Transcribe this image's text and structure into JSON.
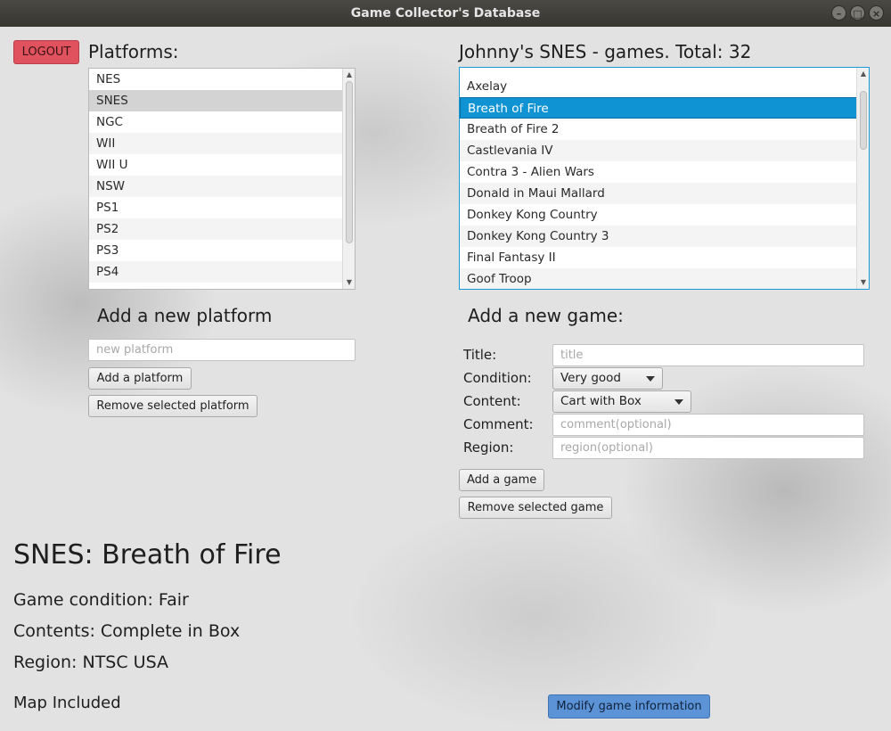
{
  "window": {
    "title": "Game Collector's Database"
  },
  "header": {
    "logout_label": "LOGOUT"
  },
  "platforms": {
    "heading": "Platforms:",
    "items": [
      "NES",
      "SNES",
      "NGC",
      "WII",
      "WII U",
      "NSW",
      "PS1",
      "PS2",
      "PS3",
      "PS4"
    ],
    "selected": "SNES",
    "add_heading": "Add a new platform",
    "new_placeholder": "new platform",
    "add_button": "Add a platform",
    "remove_button": "Remove selected platform"
  },
  "games": {
    "heading": "Johnny's SNES - games. Total: 32",
    "items": [
      "Axelay",
      "Breath of Fire",
      "Breath of Fire 2",
      "Castlevania IV",
      "Contra 3 - Alien Wars",
      "Donald in Maui Mallard",
      "Donkey Kong Country",
      "Donkey Kong Country 3",
      "Final Fantasy II",
      "Goof Troop"
    ],
    "selected": "Breath of Fire",
    "add_heading": "Add a new game:",
    "form": {
      "title_label": "Title:",
      "title_placeholder": "title",
      "condition_label": "Condition:",
      "condition_value": "Very good",
      "content_label": "Content:",
      "content_value": "Cart with Box",
      "comment_label": "Comment:",
      "comment_placeholder": "comment(optional)",
      "region_label": "Region:",
      "region_placeholder": "region(optional)"
    },
    "add_button": "Add a game",
    "remove_button": "Remove selected game"
  },
  "details": {
    "title": "SNES: Breath of Fire",
    "condition": "Game condition: Fair",
    "contents": "Contents: Complete in Box",
    "region": "Region: NTSC USA",
    "note": "Map Included",
    "modify_button": "Modify game information"
  },
  "colors": {
    "accent_blue": "#0f93d2",
    "logout_red": "#e0525d",
    "modify_blue": "#5b93d6"
  }
}
